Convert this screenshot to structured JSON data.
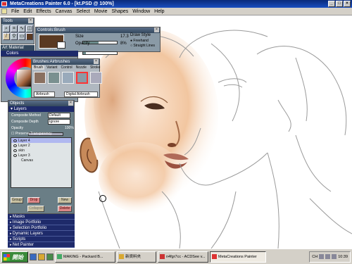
{
  "titlebar": {
    "title": "MetaCreations Painter 6.0 - [kt.PSD @ 100%]"
  },
  "menu": [
    "File",
    "Edit",
    "Effects",
    "Canvas",
    "Select",
    "Movie",
    "Shapes",
    "Window",
    "Help"
  ],
  "tools": {
    "title": "Tools"
  },
  "art_materials": {
    "label": "Art Material",
    "colors_label": "Colors"
  },
  "controls": {
    "title": "Controls:Brush",
    "size_label": "Size",
    "size_value": "17.3",
    "size_fraction": 0.45,
    "opacity_label": "Opacity",
    "opacity_value": "8%",
    "opacity_fraction": 0.08,
    "draw_style_label": "Draw Style",
    "freehand_label": "Freehand",
    "straight_label": "Straight Lines"
  },
  "brushes": {
    "title": "Brushes:Airbrushes",
    "tabs": [
      "Brush",
      "Variant",
      "Control",
      "Nozzle",
      "Stroke"
    ],
    "category_label": "Airbrush",
    "variant_label": "Digital Airbrush"
  },
  "objects": {
    "title": "Objects",
    "layers_label": "Layers",
    "composite_method_label": "Composite Method",
    "composite_method_value": "Default",
    "composite_depth_label": "Composite Depth",
    "composite_depth_value": "Ignore",
    "opacity_label": "Opacity",
    "opacity_value": "100%",
    "preserve_label": "Preserve Transparency",
    "layers": [
      "Layer 4",
      "Layer 2",
      "skin",
      "Layer 3",
      "Canvas"
    ],
    "buttons": {
      "group": "Group",
      "drop": "Drop",
      "collapse": "Collapse",
      "new": "New",
      "delete": "Delete"
    },
    "sections": [
      "Masks",
      "Image Portfolio",
      "Selection Portfolio",
      "Dynamic Layers",
      "Scripts",
      "Net Painter"
    ]
  },
  "taskbar": {
    "start": "開始",
    "buttons": [
      "MAKING - Packard B...",
      "新資料夾",
      "n4fgr7cc - ACDSee v...",
      "MetaCreations Painter"
    ],
    "tray_lang": "CH",
    "clock": "10:39"
  },
  "colors": {
    "accent": "#1a4fc0",
    "palette": "#8a9aa6",
    "selected_color": "#5a3a22"
  }
}
